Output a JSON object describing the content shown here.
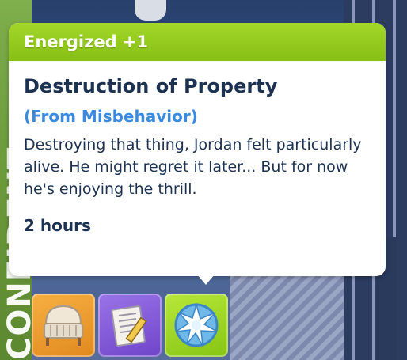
{
  "side_label": "CONFIDENT",
  "tooltip": {
    "header": "Energized +1",
    "title": "Destruction of Property",
    "source": "(From Misbehavior)",
    "description": "Destroying that thing, Jordan felt particularly alive. He might regret it later... But for now he's enjoying the thrill.",
    "duration": "2 hours"
  },
  "moodlets": [
    {
      "icon": "crib-icon",
      "color": "#e99a2a"
    },
    {
      "icon": "note-pencil-icon",
      "color": "#7e55d6"
    },
    {
      "icon": "burst-icon",
      "color": "#9fd42a"
    }
  ],
  "colors": {
    "header_green": "#94c91c",
    "title_navy": "#1d3250",
    "source_blue": "#3a8ae0"
  }
}
